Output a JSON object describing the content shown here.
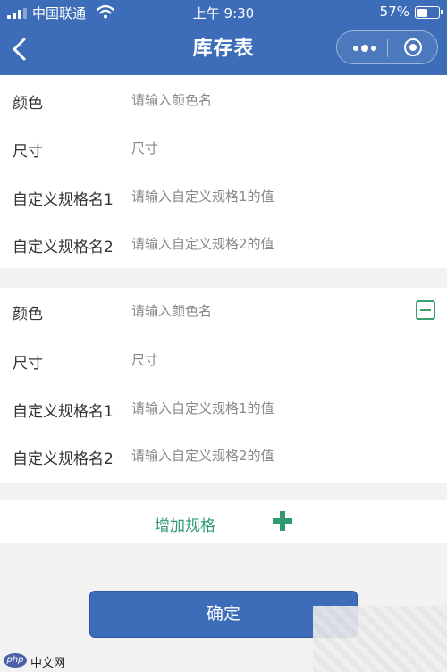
{
  "status": {
    "carrier": "中国联通",
    "time": "上午 9:30",
    "battery": "57%",
    "battery_level": 0.57
  },
  "nav": {
    "title": "库存表"
  },
  "specs": [
    {
      "color_label": "颜色",
      "color_placeholder": "请输入颜色名",
      "size_label": "尺寸",
      "size_placeholder": "尺寸",
      "custom1_label": "自定义规格名1",
      "custom1_placeholder": "请输入自定义规格1的值",
      "custom2_label": "自定义规格名2",
      "custom2_placeholder": "请输入自定义规格2的值"
    },
    {
      "color_label": "颜色",
      "color_placeholder": "请输入颜色名",
      "size_label": "尺寸",
      "size_placeholder": "尺寸",
      "custom1_label": "自定义规格名1",
      "custom1_placeholder": "请输入自定义规格1的值",
      "custom2_label": "自定义规格名2",
      "custom2_placeholder": "请输入自定义规格2的值"
    }
  ],
  "actions": {
    "add_label": "增加规格",
    "confirm_label": "确定"
  },
  "watermark": {
    "logo": "php",
    "text": "中文网"
  },
  "icons": {
    "back": "chevron-left-icon",
    "more": "more-dots-icon",
    "close": "close-circle-icon",
    "remove": "minus-square-icon",
    "add": "plus-icon"
  },
  "colors": {
    "primary": "#3d6db8",
    "accent": "#2f9a70",
    "background": "#f2f2f2"
  }
}
